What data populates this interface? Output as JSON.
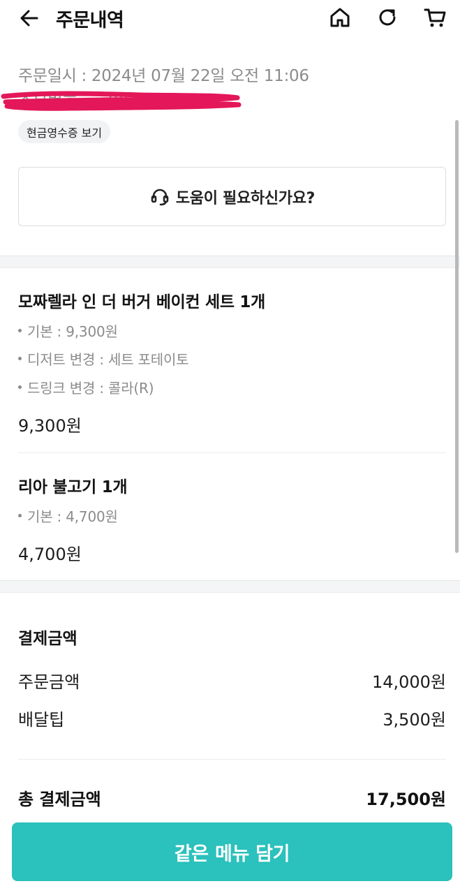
{
  "header": {
    "title": "주문내역",
    "icons": [
      "back-arrow-icon",
      "home-icon",
      "refresh-icon",
      "cart-icon"
    ]
  },
  "order": {
    "date": "주문일시 : 2024년 07월 22일 오전 11:06",
    "number_partial": "주문번호 : ...90300",
    "receipt_label": "현금영수증 보기"
  },
  "help": {
    "label": "도움이 필요하신가요?",
    "icon": "headset-icon"
  },
  "items": [
    {
      "name": "모짜렐라 인 더 버거 베이컨 세트 1개",
      "options": [
        "기본 : 9,300원",
        "디저트 변경 : 세트 포테이토",
        "드링크 변경 : 콜라(R)"
      ],
      "price": "9,300원"
    },
    {
      "name": "리아 불고기 1개",
      "options": [
        "기본 : 4,700원"
      ],
      "price": "4,700원"
    }
  ],
  "payment": {
    "title": "결제금액",
    "rows": [
      {
        "label": "주문금액",
        "value": "14,000원"
      },
      {
        "label": "배달팁",
        "value": "3,500원"
      }
    ],
    "total_label": "총 결제금액",
    "total_value": "17,500원"
  },
  "cta": {
    "label": "같은 메뉴 담기"
  },
  "colors": {
    "accent": "#2bc1bc",
    "redaction": "#e3175a",
    "muted": "#8b8b8b"
  }
}
